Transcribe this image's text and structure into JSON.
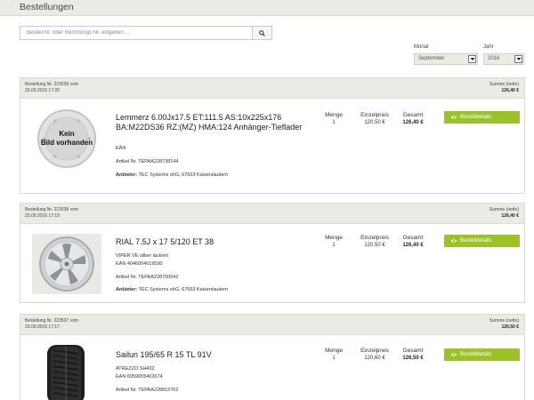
{
  "header": {
    "title": "Bestellungen"
  },
  "search": {
    "placeholder": "Bestell Nr. oder Rechnungs Nr. eingeben ..."
  },
  "filters": {
    "month_label": "Monat",
    "month_value": "September",
    "year_label": "Jahr",
    "year_value": "2016"
  },
  "columns": {
    "qty": "Menge",
    "unit_price": "Einzelpreis",
    "total": "Gesamt"
  },
  "detail_button_label": "Bestelldetails",
  "placeholder_image_text": {
    "line1": "Kein",
    "line2": "Bild vorhanden"
  },
  "orders": [
    {
      "meta_line1": "Bestellung Nr. 223539 vom",
      "meta_line2": "23.09.2016 17:20",
      "sum_label": "Summe (netto)",
      "sum_value": "126,40 €",
      "name_line1": "Lemmerz 6.00Jx17.5 ET:111.5 AS:10x225x176",
      "name_line2": "BA:M22DS36 RZ:(MZ) HMA:124 Anhänger-Tieflader",
      "ean": "EAN",
      "article": "Artikel Nr. TEPAA228738144",
      "provider_label": "Anbieter:",
      "provider": "TEC Systems ohG, 67663 Kaiserslautern",
      "qty": "1",
      "unit_price": "120,50 €",
      "total": "126,40 €"
    },
    {
      "meta_line1": "Bestellung Nr. 223538 vom",
      "meta_line2": "23.09.2016 17:19",
      "sum_label": "Summe (netto)",
      "sum_value": "126,40 €",
      "name_line1": "RIAL 7.5J x 17 5/120 ET 38",
      "variant": "VIPER VE silber lackiert",
      "ean": "EAN 4046004019590",
      "article": "Artikel Nr. TEPAA228700042",
      "provider_label": "Anbieter:",
      "provider": "TEC Systems ohG, 67663 Kaiserslautern",
      "qty": "1",
      "unit_price": "120,50 €",
      "total": "126,40 €"
    },
    {
      "meta_line1": "Bestellung Nr. 223537 vom",
      "meta_line2": "23.09.2016 17:17",
      "sum_label": "Summe (netto)",
      "sum_value": "126,50 €",
      "name_line1": "Sailun 195/65 R 15 TL 91V",
      "variant": "ATREZZO SH402",
      "ean": "EAN 6959655402674",
      "article": "Artikel Nr. TEPAA228812762",
      "qty": "1",
      "unit_price": "120,60 €",
      "total": "126,50 €"
    }
  ]
}
